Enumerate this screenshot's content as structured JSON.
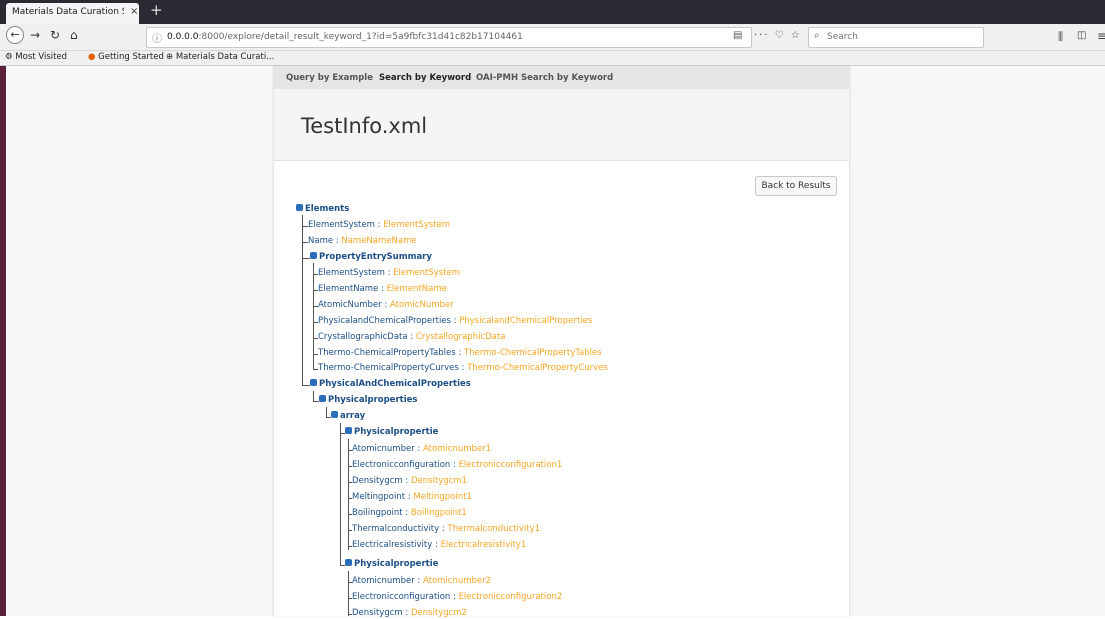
{
  "browser": {
    "tab_title": "Materials Data Curation Sy",
    "tab_close": "×",
    "new_tab": "+",
    "url_prefix": "",
    "url_host": "0.0.0.0",
    "url_rest": ":8000/explore/detail_result_keyword_1?id=5a9fbfc31d41c82b17104461",
    "urlbar_actions": "··· ♡ ☆",
    "search_placeholder": "Search",
    "bookmarks": [
      "Most Visited",
      "Getting Started",
      "Materials Data Curati..."
    ]
  },
  "subnav": {
    "query_by_example": "Query by Example",
    "search_by_keyword": "Search by Keyword",
    "oai_search": "OAI-PMH Search by Keyword"
  },
  "page": {
    "title": "TestInfo.xml",
    "back_button": "Back to Results"
  },
  "tree": {
    "elements": "Elements",
    "element_system_key": "ElementSystem",
    "element_system_val": "ElementSystem",
    "name_key": "Name",
    "name_val": "NameNameName",
    "pes": "PropertyEntrySummary",
    "pes_items": [
      {
        "key": "ElementSystem",
        "val": "ElementSystem"
      },
      {
        "key": "ElementName",
        "val": "ElementName"
      },
      {
        "key": "AtomicNumber",
        "val": "AtomicNumber"
      },
      {
        "key": "PhysicalandChemicalProperties",
        "val": "PhysicalandChemicalProperties"
      },
      {
        "key": "CrystallographicData",
        "val": "CrystallographicData"
      },
      {
        "key": "Thermo-ChemicalPropertyTables",
        "val": "Thermo-ChemicalPropertyTables"
      },
      {
        "key": "Thermo-ChemicalPropertyCurves",
        "val": "Thermo-ChemicalPropertyCurves"
      }
    ],
    "pacp": "PhysicalAndChemicalProperties",
    "physicalproperties": "Physicalproperties",
    "array": "array",
    "propertie1": "Physicalpropertie",
    "propertie1_items": [
      {
        "key": "Atomicnumber",
        "val": "Atomicnumber1"
      },
      {
        "key": "Electronicconfiguration",
        "val": "Electronicconfiguration1"
      },
      {
        "key": "Densitygcm",
        "val": "Densitygcm1"
      },
      {
        "key": "Meltingpoint",
        "val": "Meltingpoint1"
      },
      {
        "key": "Boilingpoint",
        "val": "Boilingpoint1"
      },
      {
        "key": "Thermalconductivity",
        "val": "Thermalconductivity1"
      },
      {
        "key": "Electricalresistivity",
        "val": "Electricalresistivity1"
      }
    ],
    "propertie2": "Physicalpropertie",
    "propertie2_items": [
      {
        "key": "Atomicnumber",
        "val": "Atomicnumber2"
      },
      {
        "key": "Electronicconfiguration",
        "val": "Electronicconfiguration2"
      },
      {
        "key": "Densitygcm",
        "val": "Densitygcm2"
      }
    ],
    "separator": " : "
  },
  "colors": {
    "key": "#1c4f86",
    "value": "#f5a623",
    "toggle": "#2a6ebb",
    "titlebar": "#2b2a33",
    "frame": "#5b1f3c"
  },
  "icons": [
    "back-arrow-icon",
    "forward-arrow-icon",
    "reload-icon",
    "home-icon",
    "info-icon",
    "reader-view-icon",
    "pocket-icon",
    "bookmark-star-icon",
    "search-icon",
    "library-icon",
    "sidebar-icon",
    "menu-icon",
    "toggle-minus-icon"
  ]
}
